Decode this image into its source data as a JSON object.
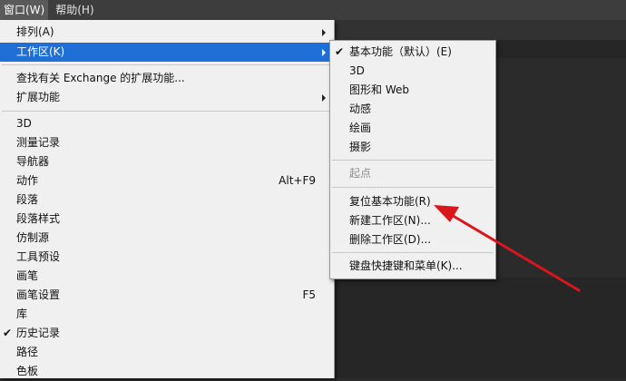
{
  "menubar": {
    "window_label": "窗口(W)",
    "help_label": "帮助(H)"
  },
  "window_menu": {
    "arrange": "排列(A)",
    "workspace": "工作区(K)",
    "find_exchange": "查找有关 Exchange 的扩展功能...",
    "extensions": "扩展功能",
    "panels": [
      {
        "label": "3D",
        "shortcut": ""
      },
      {
        "label": "测量记录",
        "shortcut": ""
      },
      {
        "label": "导航器",
        "shortcut": ""
      },
      {
        "label": "动作",
        "shortcut": "Alt+F9"
      },
      {
        "label": "段落",
        "shortcut": ""
      },
      {
        "label": "段落样式",
        "shortcut": ""
      },
      {
        "label": "仿制源",
        "shortcut": ""
      },
      {
        "label": "工具预设",
        "shortcut": ""
      },
      {
        "label": "画笔",
        "shortcut": ""
      },
      {
        "label": "画笔设置",
        "shortcut": "F5"
      },
      {
        "label": "库",
        "shortcut": ""
      },
      {
        "label": "历史记录",
        "shortcut": ""
      },
      {
        "label": "路径",
        "shortcut": ""
      },
      {
        "label": "色板",
        "shortcut": ""
      }
    ],
    "checkmark": "✔"
  },
  "workspace_menu": {
    "essentials_default": "基本功能（默认）(E)",
    "3d": "3D",
    "graphic_web": "图形和 Web",
    "motion": "动感",
    "painting": "绘画",
    "photography": "摄影",
    "starting": "起点",
    "reset_essentials": "复位基本功能(R)",
    "new_workspace": "新建工作区(N)...",
    "delete_workspace": "删除工作区(D)...",
    "keyboard_shortcuts": "键盘快捷键和菜单(K)..."
  },
  "colors": {
    "highlight": "#1f6fd6",
    "annotation_arrow": "#d9161c"
  }
}
